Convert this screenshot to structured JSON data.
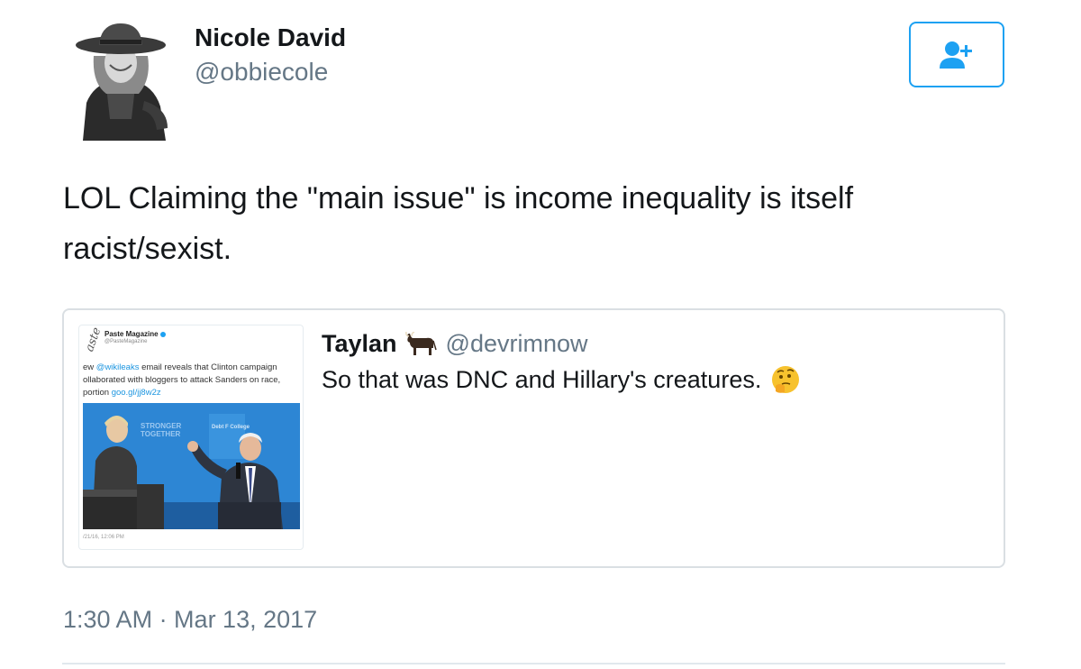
{
  "author": {
    "name": "Nicole David",
    "handle": "@obbiecole"
  },
  "follow_button": {
    "icon": "follow-user-icon",
    "accent": "#1da1f2"
  },
  "tweet": {
    "text": "LOL Claiming the \"main issue\" is income inequality is itself racist/sexist.",
    "timestamp": "1:30 AM · Mar 13, 2017"
  },
  "quoted_tweet": {
    "name": "Taylan",
    "name_emoji": "ox-icon",
    "handle": "@devrimnow",
    "text": "So that was DNC and Hillary's creatures.",
    "text_emoji": "thinking-face-icon",
    "media": {
      "logo": "aste",
      "account_name": "Paste Magazine",
      "account_handle": "@PasteMagazine",
      "text_prefix": "ew ",
      "mention": "@wikileaks",
      "text_line1": " email reveals that Clinton campaign",
      "text_line2": "ollaborated with bloggers to attack Sanders on race,",
      "text_line3_prefix": "portion ",
      "link": "goo.gl/jj8w2z",
      "banner_text_1": "STRONGER",
      "banner_text_2": "TOGETHER",
      "sign_text": "Debt F College",
      "date": "/21/16, 12:06 PM"
    }
  },
  "colors": {
    "text_primary": "#14171a",
    "text_secondary": "#657786",
    "border": "#dadfe3",
    "link": "#1b95e0"
  }
}
